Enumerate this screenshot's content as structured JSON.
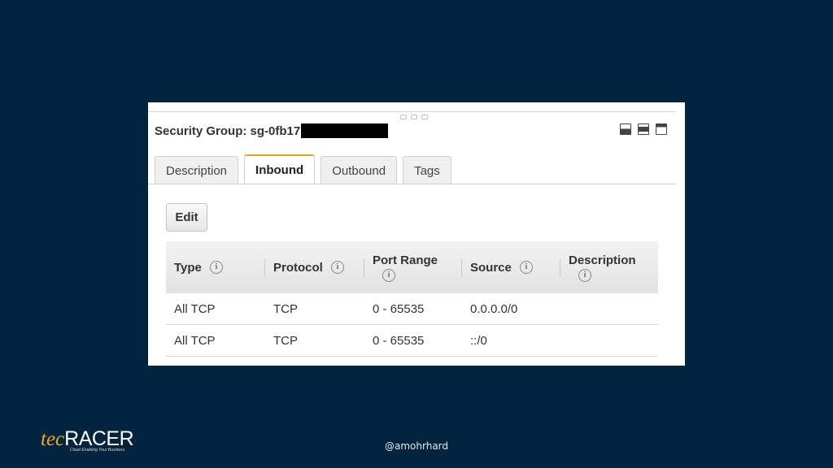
{
  "security_group": {
    "title": "Security Group: sg-0fb17"
  },
  "tabs": [
    {
      "label": "Description"
    },
    {
      "label": "Inbound"
    },
    {
      "label": "Outbound"
    },
    {
      "label": "Tags"
    }
  ],
  "active_tab": "Inbound",
  "edit_label": "Edit",
  "table": {
    "columns": [
      "Type",
      "Protocol",
      "Port Range",
      "Source",
      "Description"
    ],
    "rows": [
      [
        "All TCP",
        "TCP",
        "0 - 65535",
        "0.0.0.0/0",
        ""
      ],
      [
        "All TCP",
        "TCP",
        "0 - 65535",
        "::/0",
        ""
      ]
    ]
  },
  "footer": {
    "handle": "@amohrhard",
    "logo_tec": "tec",
    "logo_racer": "RACER",
    "logo_tagline": "Cloud Enabling Your Business"
  },
  "colors": {
    "background": "#02243f",
    "accent": "#e8a21b"
  }
}
